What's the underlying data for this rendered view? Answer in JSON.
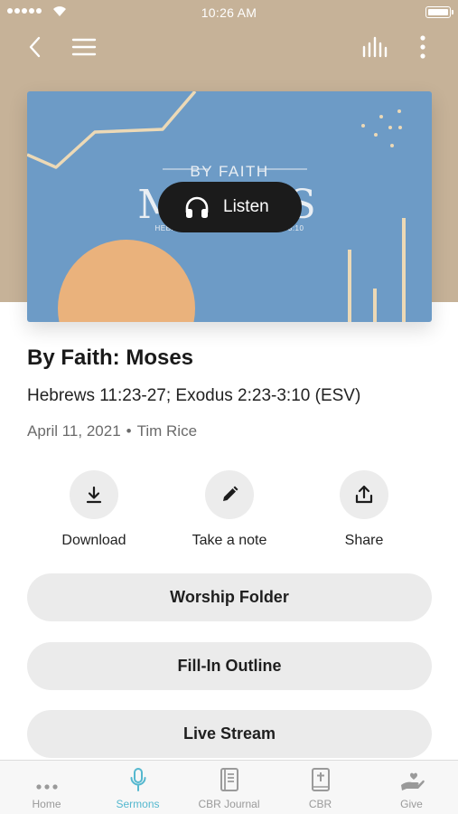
{
  "status_bar": {
    "time": "10:26 AM"
  },
  "nav": {
    "back_icon": "chevron-left-icon",
    "menu_icon": "hamburger-menu-icon",
    "audio_icon": "audio-bars-icon",
    "more_icon": "more-vertical-icon"
  },
  "artwork": {
    "title_small": "BY FAITH",
    "title_big": "MOSES",
    "reference": "HEBREWS 11:23-27; EXODUS 2:23-3:10",
    "listen_label": "Listen",
    "colors": {
      "background": "#6d9bc6",
      "sun": "#eab27c",
      "lines": "#ecd9b6"
    }
  },
  "sermon": {
    "title": "By Faith: Moses",
    "scripture": "Hebrews 11:23-27; Exodus 2:23-3:10 (ESV)",
    "date": "April 11, 2021",
    "speaker": "Tim Rice"
  },
  "actions": [
    {
      "label": "Download",
      "icon": "download-icon"
    },
    {
      "label": "Take a note",
      "icon": "pencil-icon"
    },
    {
      "label": "Share",
      "icon": "share-icon"
    }
  ],
  "links": [
    {
      "label": "Worship Folder"
    },
    {
      "label": "Fill-In Outline"
    },
    {
      "label": "Live Stream"
    }
  ],
  "tabs": [
    {
      "label": "Home",
      "icon": "more-horizontal-icon"
    },
    {
      "label": "Sermons",
      "icon": "microphone-icon",
      "active": true
    },
    {
      "label": "CBR Journal",
      "icon": "journal-icon"
    },
    {
      "label": "CBR",
      "icon": "bible-icon"
    },
    {
      "label": "Give",
      "icon": "giving-hand-icon"
    }
  ],
  "colors": {
    "accent": "#55b8cf",
    "hero_background": "#c6b298"
  }
}
